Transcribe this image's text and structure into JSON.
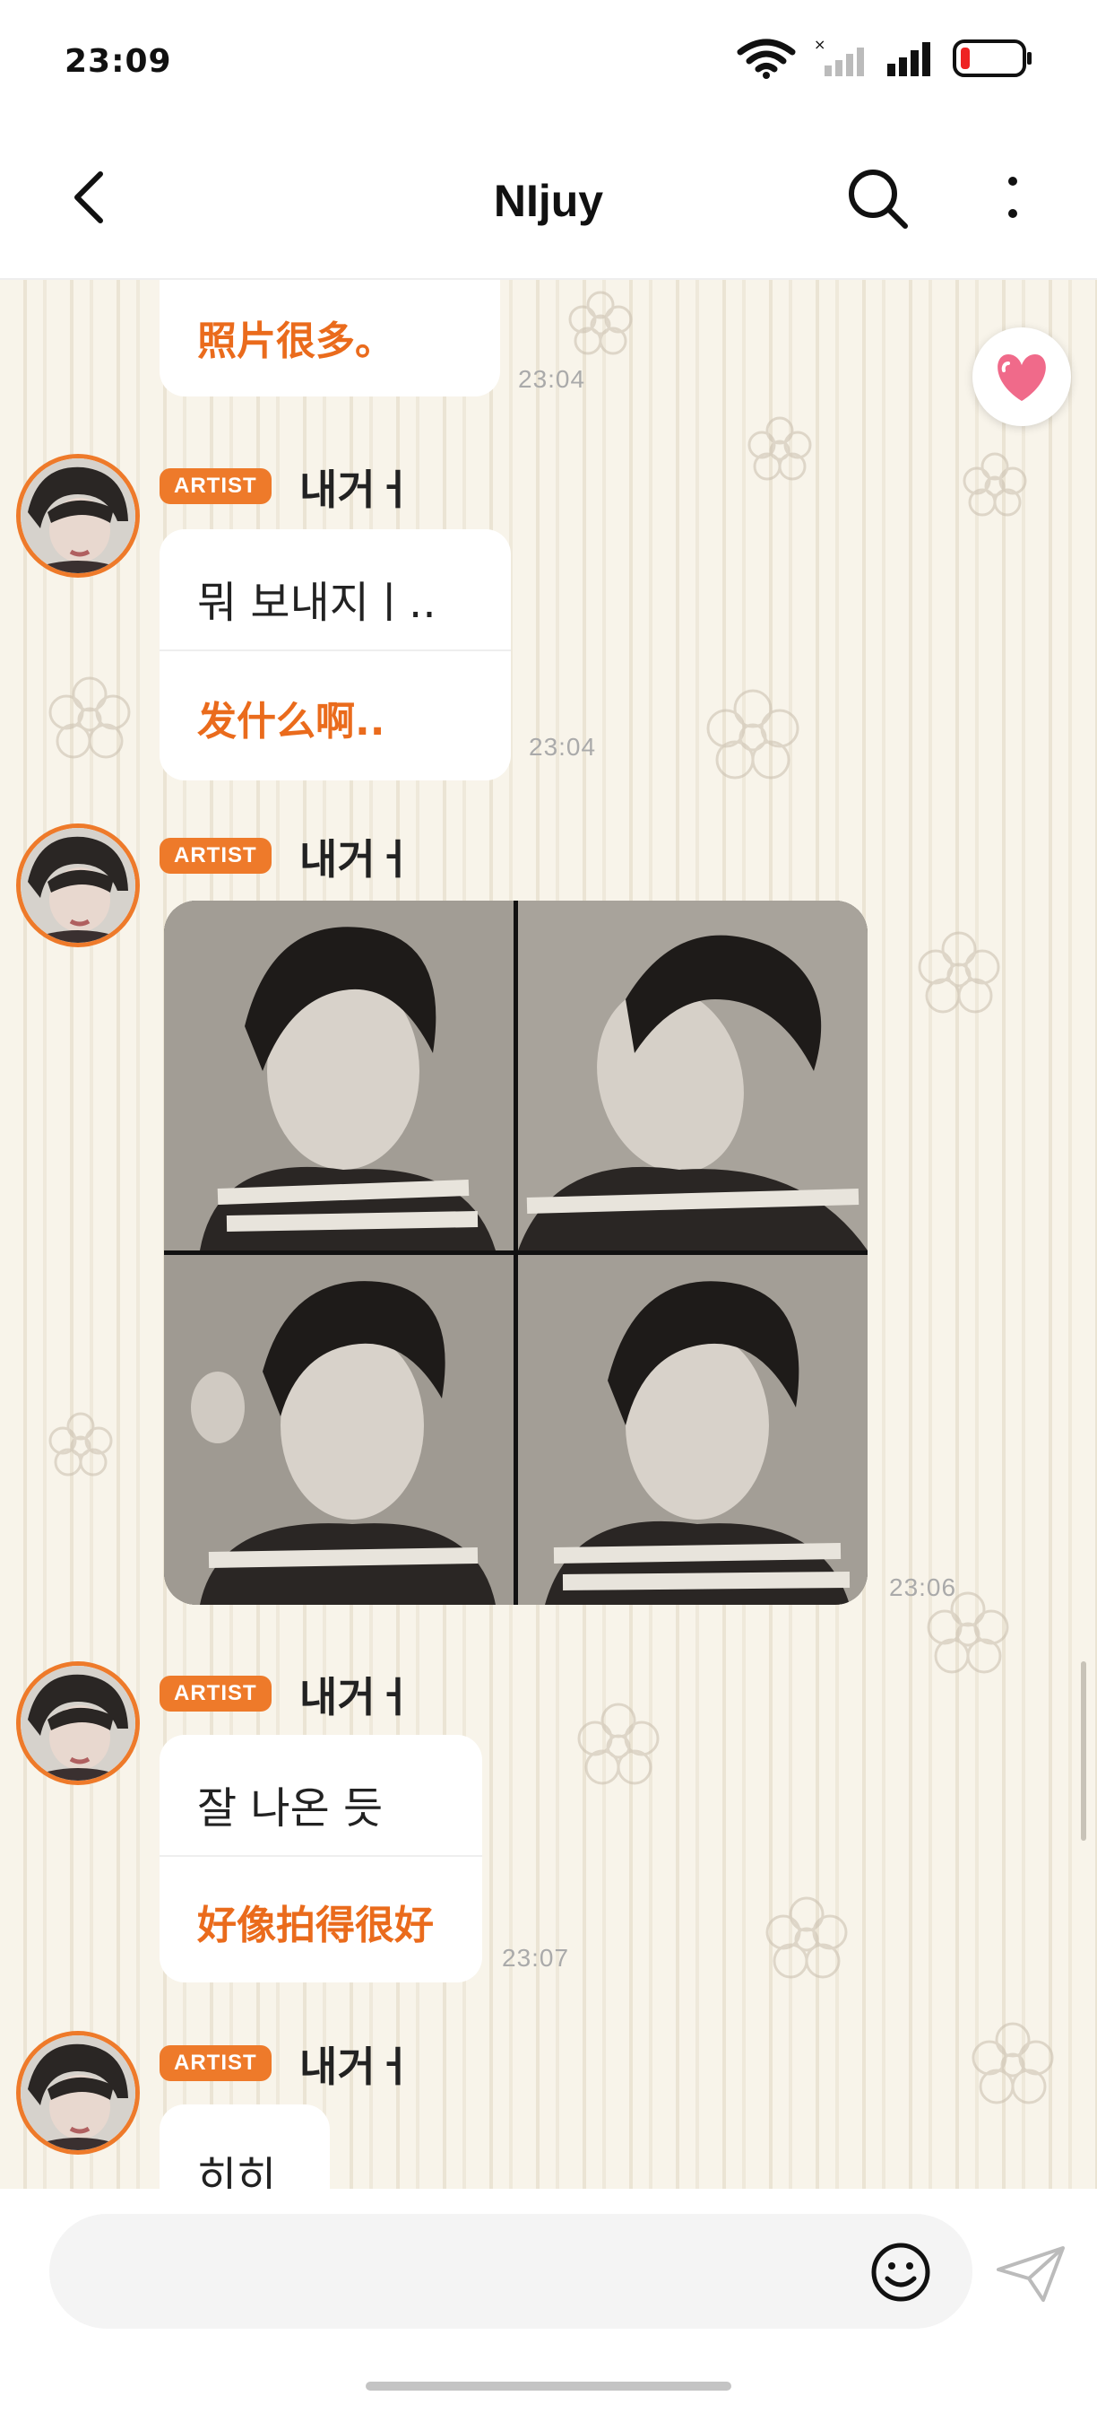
{
  "status_bar": {
    "time": "23:09"
  },
  "header": {
    "title": "NIjuy"
  },
  "messages": [
    {
      "cn": "照片很多。",
      "time": "23:04"
    },
    {
      "badge": "ARTIST",
      "name": "내거ㅓ",
      "ko": "뭐 보내지ㅣ..",
      "cn": "发什么啊..",
      "time": "23:04"
    },
    {
      "badge": "ARTIST",
      "name": "내거ㅓ",
      "time": "23:06"
    },
    {
      "badge": "ARTIST",
      "name": "내거ㅓ",
      "ko": "잘 나온 듯",
      "cn": "好像拍得很好",
      "time": "23:07"
    },
    {
      "badge": "ARTIST",
      "name": "내거ㅓ",
      "ko": "히히"
    }
  ],
  "colors": {
    "accent": "#ee7a2a",
    "translation": "#ea6b1c"
  },
  "icons": [
    "back-arrow-icon",
    "search-icon",
    "more-vertical-icon",
    "heart-icon",
    "emoji-icon",
    "send-icon",
    "wifi-icon",
    "signal-icon",
    "battery-icon"
  ]
}
